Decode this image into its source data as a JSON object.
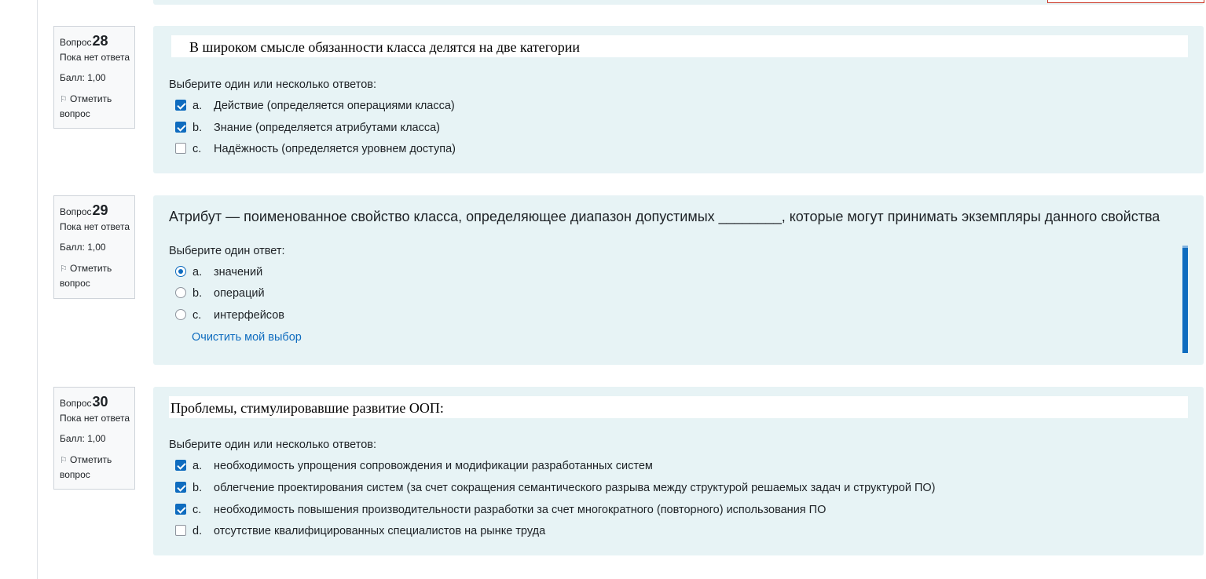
{
  "questions": [
    {
      "label": "Вопрос",
      "number": "28",
      "state": "Пока нет ответа",
      "grade": "Балл: 1,00",
      "flag_line1": "Отметить",
      "flag_line2": "вопрос",
      "text": "В широком смысле обязанности класса делятся на две категории",
      "prompt": "Выберите один или несколько ответов:",
      "type": "checkbox",
      "options": [
        {
          "letter": "a.",
          "text": "Действие (определяется операциями класса)",
          "checked": true
        },
        {
          "letter": "b.",
          "text": "Знание (определяется атрибутами класса)",
          "checked": true
        },
        {
          "letter": "c.",
          "text": "Надёжность (определяется уровнем доступа)",
          "checked": false
        }
      ]
    },
    {
      "label": "Вопрос",
      "number": "29",
      "state": "Пока нет ответа",
      "grade": "Балл: 1,00",
      "flag_line1": "Отметить",
      "flag_line2": "вопрос",
      "text": "Атрибут — поименованное свойство класса, определяющее диапазон допустимых ________, которые могут принимать экземпляры данного свойства",
      "prompt": "Выберите один ответ:",
      "type": "radio",
      "options": [
        {
          "letter": "a.",
          "text": "значений",
          "checked": true
        },
        {
          "letter": "b.",
          "text": "операций",
          "checked": false
        },
        {
          "letter": "c.",
          "text": "интерфейсов",
          "checked": false
        }
      ],
      "clear_label": "Очистить мой выбор"
    },
    {
      "label": "Вопрос",
      "number": "30",
      "state": "Пока нет ответа",
      "grade": "Балл: 1,00",
      "flag_line1": "Отметить",
      "flag_line2": "вопрос",
      "text": "Проблемы, стимулировавшие развитие ООП:",
      "prompt": "Выберите один или несколько ответов:",
      "type": "checkbox",
      "options": [
        {
          "letter": "a.",
          "text": "необходимость упрощения сопровождения и модификации разработанных систем",
          "checked": true
        },
        {
          "letter": "b.",
          "text": "облегчение проектирования систем (за счет сокращения семантического разрыва между структурой решаемых задач и структурой ПО)",
          "checked": true
        },
        {
          "letter": "c.",
          "text": "необходимость повышения производительности разработки за счет многократного (повторного) использования ПО",
          "checked": true
        },
        {
          "letter": "d.",
          "text": "отсутствие квалифицированных специалистов на рынке труда",
          "checked": false
        }
      ]
    }
  ],
  "icons": {
    "flag": "flag-icon"
  },
  "colors": {
    "accent": "#0f6cbf",
    "content_bg": "#e7f3f5",
    "info_bg": "#f8f9fa"
  }
}
